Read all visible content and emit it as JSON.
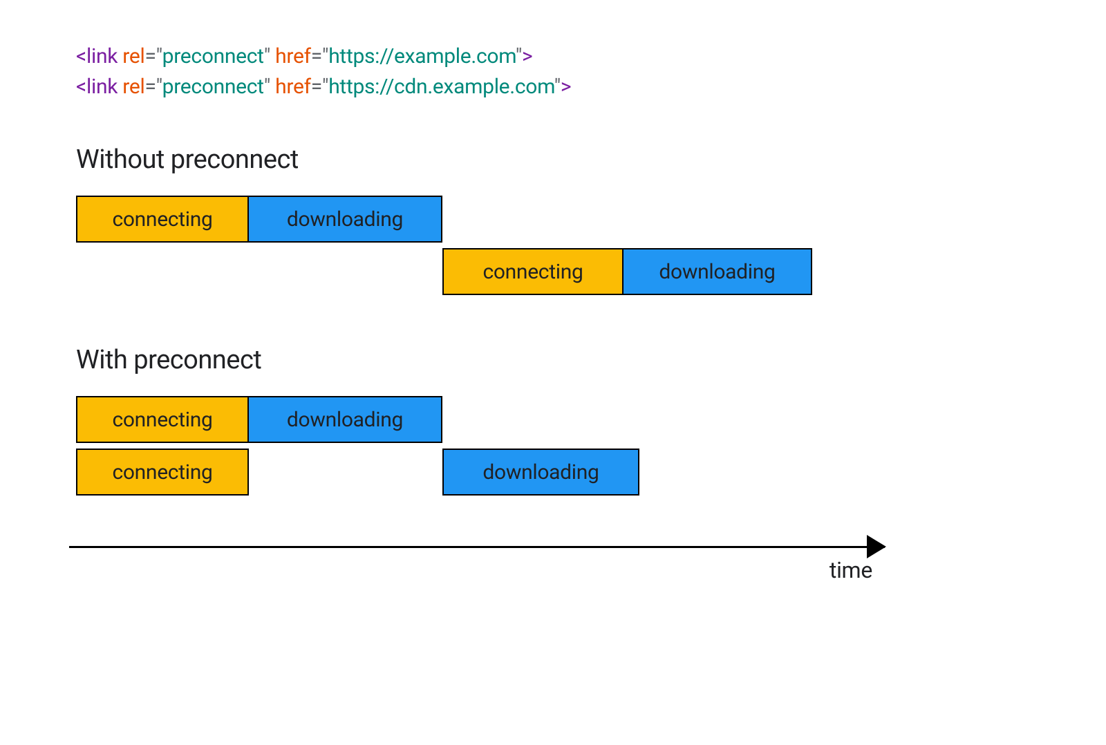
{
  "code": {
    "tag": "<link",
    "attr_rel": "rel",
    "eq_open": "=\"",
    "rel_val": "preconnect",
    "close_q": "\"",
    "attr_href": "href",
    "href1": "https://example.com",
    "href2": "https://cdn.example.com",
    "tag_close": ">"
  },
  "sections": {
    "without": "Without preconnect",
    "with": "With preconnect"
  },
  "labels": {
    "connecting": "connecting",
    "downloading": "downloading"
  },
  "axis": {
    "label": "time"
  },
  "chart_data": {
    "type": "bar",
    "axis": "time (relative units, arbitrary)",
    "legend": {
      "connecting": "#fbbc04",
      "downloading": "#2196f3"
    },
    "scenarios": [
      {
        "name": "Without preconnect",
        "rows": [
          {
            "segments": [
              {
                "phase": "connecting",
                "start": 0,
                "end": 250
              },
              {
                "phase": "downloading",
                "start": 250,
                "end": 530
              }
            ]
          },
          {
            "segments": [
              {
                "phase": "connecting",
                "start": 530,
                "end": 790
              },
              {
                "phase": "downloading",
                "start": 790,
                "end": 1065
              }
            ]
          }
        ]
      },
      {
        "name": "With preconnect",
        "rows": [
          {
            "segments": [
              {
                "phase": "connecting",
                "start": 0,
                "end": 250
              },
              {
                "phase": "downloading",
                "start": 250,
                "end": 530
              }
            ]
          },
          {
            "segments": [
              {
                "phase": "connecting",
                "start": 0,
                "end": 250
              },
              {
                "phase": "downloading",
                "start": 530,
                "end": 815
              }
            ]
          }
        ]
      }
    ]
  }
}
